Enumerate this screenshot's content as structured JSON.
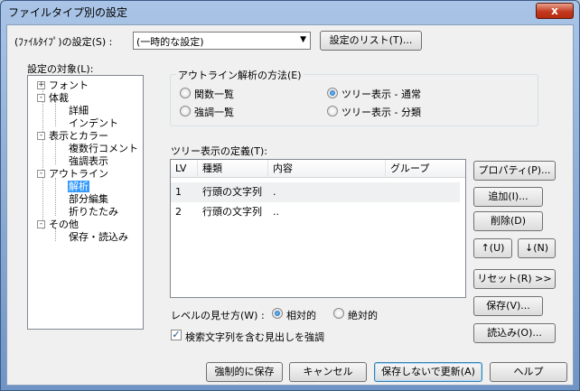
{
  "window": {
    "title": "ファイルタイプ別の設定",
    "close_label": "x"
  },
  "filetype": {
    "label": "(ﾌｧｲﾙﾀｲﾌﾟ)の設定(S) :",
    "selected": "(一時的な設定)",
    "list_button": "設定のリスト(T)..."
  },
  "target": {
    "label": "設定の対象(L):",
    "tree": [
      {
        "label": "フォント",
        "level": 0,
        "expander": "+"
      },
      {
        "label": "体裁",
        "level": 0,
        "expander": "-"
      },
      {
        "label": "詳細",
        "level": 1
      },
      {
        "label": "インデント",
        "level": 1
      },
      {
        "label": "表示とカラー",
        "level": 0,
        "expander": "-"
      },
      {
        "label": "複数行コメント",
        "level": 1
      },
      {
        "label": "強調表示",
        "level": 1
      },
      {
        "label": "アウトライン",
        "level": 0,
        "expander": "-"
      },
      {
        "label": "解析",
        "level": 1,
        "selected": true
      },
      {
        "label": "部分編集",
        "level": 1
      },
      {
        "label": "折りたたみ",
        "level": 1
      },
      {
        "label": "その他",
        "level": 0,
        "expander": "-"
      },
      {
        "label": "保存・読込み",
        "level": 1
      }
    ]
  },
  "outline": {
    "group_title": "アウトライン解析の方法(E)",
    "options": [
      {
        "label": "関数一覧",
        "checked": false
      },
      {
        "label": "ツリー表示 - 通常",
        "checked": true
      },
      {
        "label": "強調一覧",
        "checked": false
      },
      {
        "label": "ツリー表示 - 分類",
        "checked": false
      }
    ]
  },
  "tree_def": {
    "label": "ツリー表示の定義(T):",
    "columns": [
      "LV",
      "種類",
      "内容",
      "グループ"
    ],
    "rows": [
      {
        "lv": "1",
        "type": "行頭の文字列",
        "content": ".",
        "group": ""
      },
      {
        "lv": "2",
        "type": "行頭の文字列",
        "content": "..",
        "group": ""
      }
    ]
  },
  "side_buttons": {
    "properties": "プロパティ(P)...",
    "add": "追加(I)...",
    "delete": "削除(D)",
    "up": "↑(U)",
    "down": "↓(N)",
    "reset": "リセット(R) >>",
    "save": "保存(V)...",
    "load": "読込み(O)..."
  },
  "level_view": {
    "label": "レベルの見せ方(W) :",
    "relative": "相対的",
    "absolute": "絶対的",
    "relative_checked": true
  },
  "highlight": {
    "label": "検索文字列を含む見出しを強調",
    "checked": true
  },
  "footer": {
    "force_save": "強制的に保存",
    "cancel": "キャンセル",
    "update": "保存しないで更新(A)",
    "help": "ヘルプ"
  }
}
